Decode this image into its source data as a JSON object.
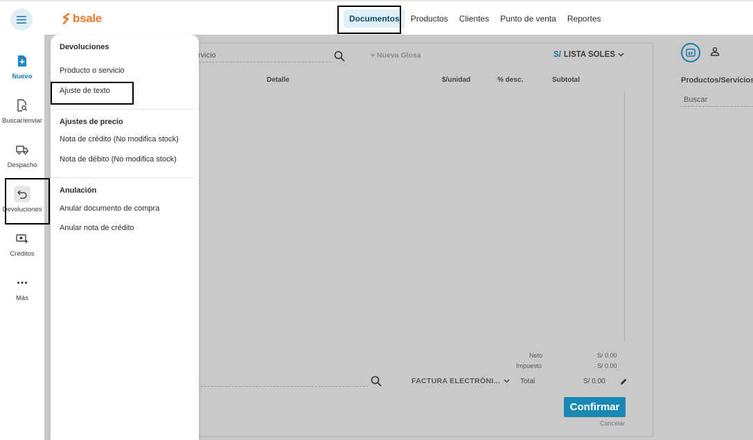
{
  "brand": {
    "name": "bsale",
    "accent": "#f0782a",
    "primary": "#1888b5"
  },
  "topnav": {
    "items": [
      {
        "label": "Documentos",
        "active": true
      },
      {
        "label": "Productos",
        "active": false
      },
      {
        "label": "Clientes",
        "active": false
      },
      {
        "label": "Punto de venta",
        "active": false
      },
      {
        "label": "Reportes",
        "active": false
      }
    ]
  },
  "sidebar": {
    "items": [
      {
        "label": "Nuevo",
        "icon": "new-document-icon"
      },
      {
        "label": "Buscar/enviar",
        "icon": "search-document-icon"
      },
      {
        "label": "Despacho",
        "icon": "truck-icon"
      },
      {
        "label": "Devoluciones",
        "icon": "return-arrow-icon"
      },
      {
        "label": "Créditos",
        "icon": "money-add-icon"
      },
      {
        "label": "Más",
        "icon": "more-dots-icon"
      }
    ]
  },
  "menu": {
    "sections": [
      {
        "title": "Devoluciones",
        "items": [
          "Producto o servicio",
          "Ajuste de texto"
        ]
      },
      {
        "title": "Ajustes de precio",
        "items": [
          "Nota de crédito (No modifica stock)",
          "Nota de débito (No modifica stock)"
        ]
      },
      {
        "title": "Anulación",
        "items": [
          "Anular documento de compra",
          "Anular nota de crédito"
        ]
      }
    ]
  },
  "document": {
    "search_text": "rvicio",
    "glosa": "+ Nueva Glosa",
    "price_list_currency": "S/",
    "price_list": "LISTA SOLES",
    "columns": [
      "Detalle",
      "$/unidad",
      "% desc.",
      "Subtotal"
    ],
    "totals": {
      "neto_label": "Neto",
      "neto_value": "S/ 0.00",
      "impuesto_label": "Impuesto",
      "impuesto_value": "S/ 0.00",
      "total_label": "Total",
      "total_value": "S/ 0.00"
    },
    "doc_type": "FACTURA ELECTRÓNI...",
    "confirm": "Confirmar",
    "cancel": "Cancelar"
  },
  "right_panel": {
    "title": "Productos/Servicios",
    "search_placeholder": "Buscar"
  }
}
